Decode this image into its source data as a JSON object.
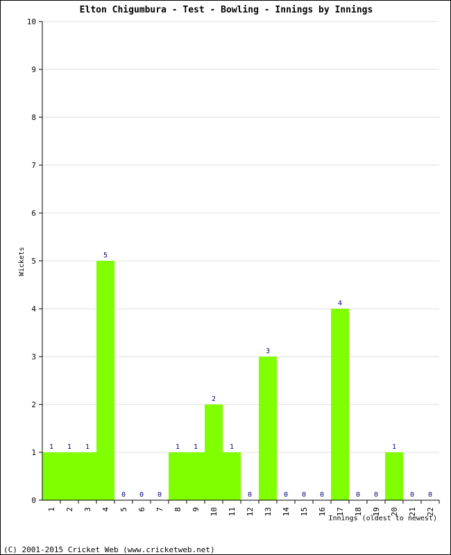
{
  "chart_data": {
    "type": "bar",
    "title": "Elton Chigumbura - Test - Bowling - Innings by Innings",
    "xlabel": "Innings (oldest to newest)",
    "ylabel": "Wickets",
    "ylim": [
      0,
      10
    ],
    "yticks": [
      0,
      1,
      2,
      3,
      4,
      5,
      6,
      7,
      8,
      9,
      10
    ],
    "grid": true,
    "categories": [
      "1",
      "2",
      "3",
      "4",
      "5",
      "6",
      "7",
      "8",
      "9",
      "10",
      "11",
      "12",
      "13",
      "14",
      "15",
      "16",
      "17",
      "18",
      "19",
      "20",
      "21",
      "22"
    ],
    "values": [
      1,
      1,
      1,
      5,
      0,
      0,
      0,
      1,
      1,
      2,
      1,
      0,
      3,
      0,
      0,
      0,
      4,
      0,
      0,
      1,
      0,
      0
    ],
    "bar_color": "#80ff00",
    "label_color": "#000080"
  },
  "footer": "(C) 2001-2015 Cricket Web (www.cricketweb.net)"
}
